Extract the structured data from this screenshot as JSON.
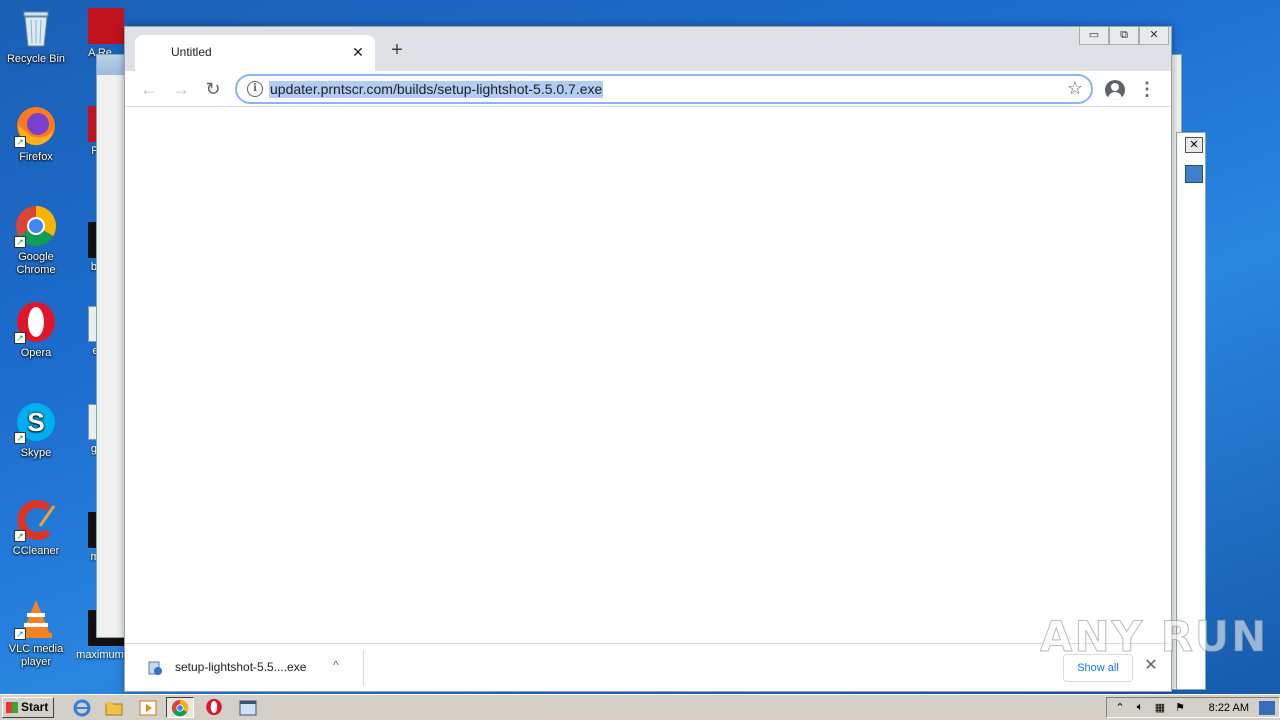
{
  "desktop": {
    "icons": [
      {
        "label": "Recycle Bin"
      },
      {
        "label": "Firefox"
      },
      {
        "label": "Google Chrome"
      },
      {
        "label": "Opera"
      },
      {
        "label": "Skype"
      },
      {
        "label": "CCleaner"
      },
      {
        "label": "VLC media player"
      }
    ],
    "icons_col2": [
      {
        "label": "A Re"
      },
      {
        "label": "File"
      },
      {
        "label": "batt"
      },
      {
        "label": "ent"
      },
      {
        "label": "geo"
      },
      {
        "label": "mar"
      },
      {
        "label": "maximum"
      }
    ]
  },
  "browser": {
    "tab_title": "Untitled",
    "tab_close": "✕",
    "new_tab": "+",
    "win_minimize": "▭",
    "win_restore": "⧉",
    "win_close": "✕",
    "back": "←",
    "forward": "→",
    "reload": "↻",
    "info": "i",
    "url": "updater.prntscr.com/builds/setup-lightshot-5.5.0.7.exe",
    "star": "☆",
    "menu": "⋮"
  },
  "downloads": {
    "file_name": "setup-lightshot-5.5....exe",
    "chevron": "^",
    "show_all": "Show all",
    "close": "✕"
  },
  "watermark": "ANY RUN",
  "taskbar": {
    "start_label": "Start",
    "clock": "8:22 AM"
  },
  "colors": {
    "accent": "#1a73e8",
    "url_highlight": "#b2cdf4",
    "omnibox_border": "#8ab4f8"
  }
}
